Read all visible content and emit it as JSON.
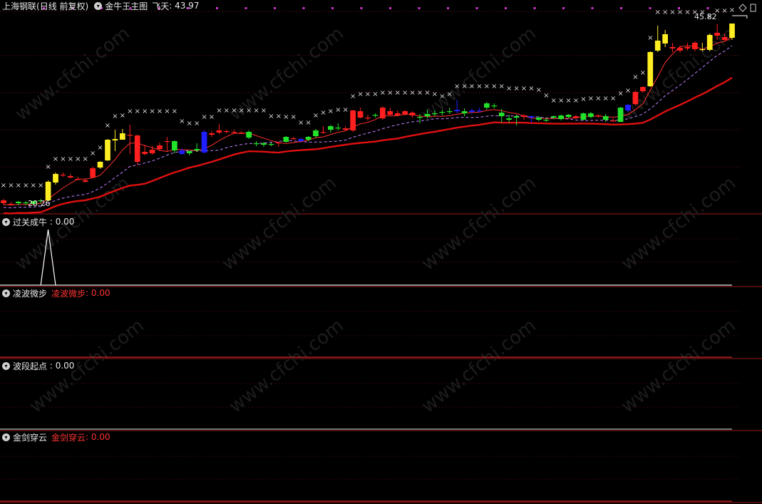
{
  "main": {
    "stock_name": "上海钢联",
    "period": "(日线 前复权)",
    "indicator": "金牛王主图",
    "line_label": "飞天",
    "line_value": "43.97",
    "high_label": "45.82",
    "low_label": "20.26"
  },
  "panels": [
    {
      "name": "过关成牛",
      "value": "0.00"
    },
    {
      "name": "凌波微步",
      "alt_name": "凌波微步",
      "value": "0.00"
    },
    {
      "name": "波段起点",
      "value": "0.00"
    },
    {
      "name": "金剑穿云",
      "alt_name": "金剑穿云",
      "value": "0.00"
    }
  ],
  "watermark": "www.cfchi.com",
  "chart_data": {
    "type": "candlestick",
    "title": "上海钢联 (日线 前复权)",
    "ylim": [
      19.5,
      47.5
    ],
    "series": [
      {
        "name": "K线",
        "note": "candles o/h/l/c/color",
        "candles": [
          [
            21.0,
            21.2,
            20.3,
            20.6,
            "r"
          ],
          [
            20.5,
            20.8,
            20.3,
            20.5,
            "r"
          ],
          [
            20.6,
            20.9,
            20.3,
            20.8,
            "g"
          ],
          [
            20.7,
            20.9,
            20.3,
            20.6,
            "g"
          ],
          [
            20.5,
            20.9,
            20.3,
            20.9,
            "g"
          ],
          [
            21.0,
            21.2,
            20.6,
            21.0,
            "g"
          ],
          [
            21.0,
            23.8,
            20.9,
            23.6,
            "y"
          ],
          [
            23.5,
            24.9,
            23.2,
            24.7,
            "y"
          ],
          [
            24.6,
            24.9,
            24.3,
            24.5,
            "r"
          ],
          [
            24.4,
            24.7,
            24.1,
            24.2,
            "r"
          ],
          [
            24.0,
            24.3,
            23.8,
            23.9,
            "r"
          ],
          [
            23.8,
            24.1,
            23.5,
            23.6,
            "r"
          ],
          [
            24.2,
            25.7,
            24.1,
            25.5,
            "r"
          ],
          [
            25.6,
            26.5,
            25.4,
            26.4,
            "y"
          ],
          [
            26.6,
            29.6,
            26.5,
            29.5,
            "y"
          ],
          [
            29.4,
            30.9,
            27.9,
            29.6,
            "y"
          ],
          [
            29.5,
            31.0,
            29.5,
            30.4,
            "y"
          ],
          [
            30.2,
            31.6,
            27.5,
            30.2,
            "r"
          ],
          [
            30.1,
            30.2,
            26.0,
            26.4,
            "r"
          ],
          [
            27.5,
            28.8,
            27.3,
            27.8,
            "r"
          ],
          [
            27.6,
            28.6,
            27.4,
            28.1,
            "r"
          ],
          [
            28.2,
            29.1,
            27.9,
            28.7,
            "r"
          ],
          [
            29.3,
            29.9,
            27.8,
            29.2,
            "r"
          ],
          [
            29.3,
            29.4,
            27.6,
            28.0,
            "g"
          ],
          [
            28.0,
            28.3,
            27.4,
            27.5,
            "b"
          ],
          [
            27.6,
            28.0,
            27.3,
            27.9,
            "g"
          ],
          [
            28.0,
            29.0,
            27.8,
            28.2,
            "g"
          ],
          [
            27.7,
            30.8,
            27.6,
            30.6,
            "b"
          ],
          [
            30.2,
            30.7,
            29.9,
            30.4,
            "r"
          ],
          [
            30.5,
            31.7,
            30.3,
            30.8,
            "r"
          ],
          [
            30.6,
            30.9,
            30.4,
            30.7,
            "r"
          ],
          [
            30.6,
            30.9,
            30.3,
            30.5,
            "r"
          ],
          [
            30.4,
            30.7,
            30.3,
            30.5,
            "r"
          ],
          [
            29.8,
            30.8,
            29.6,
            30.6,
            "g"
          ],
          [
            28.9,
            29.3,
            28.6,
            29.0,
            "g"
          ],
          [
            28.8,
            29.2,
            28.5,
            29.0,
            "g"
          ],
          [
            28.9,
            29.1,
            28.6,
            28.8,
            "g"
          ],
          [
            29.0,
            29.2,
            28.5,
            29.1,
            "r"
          ],
          [
            29.2,
            30.0,
            29.1,
            29.9,
            "g"
          ],
          [
            29.6,
            29.9,
            29.5,
            29.7,
            "r"
          ],
          [
            29.3,
            29.8,
            29.2,
            29.6,
            "b"
          ],
          [
            29.5,
            30.0,
            29.3,
            29.9,
            "g"
          ],
          [
            30.0,
            31.0,
            29.8,
            30.8,
            "g"
          ],
          [
            30.6,
            31.4,
            30.3,
            30.5,
            "r"
          ],
          [
            30.9,
            31.6,
            30.5,
            31.4,
            "g"
          ],
          [
            31.2,
            31.8,
            30.8,
            31.1,
            "g"
          ],
          [
            31.1,
            31.4,
            30.7,
            30.9,
            "r"
          ],
          [
            30.8,
            33.7,
            30.6,
            33.6,
            "r"
          ],
          [
            33.5,
            34.0,
            32.5,
            32.6,
            "r"
          ],
          [
            32.6,
            33.0,
            32.2,
            32.5,
            "r"
          ],
          [
            32.9,
            33.2,
            32.6,
            33.0,
            "g"
          ],
          [
            32.5,
            34.2,
            32.3,
            34.0,
            "r"
          ],
          [
            33.5,
            34.0,
            32.8,
            33.0,
            "r"
          ],
          [
            33.2,
            33.6,
            32.8,
            32.9,
            "r"
          ],
          [
            33.1,
            33.7,
            32.9,
            33.5,
            "r"
          ],
          [
            33.3,
            33.5,
            32.6,
            32.9,
            "r"
          ],
          [
            32.6,
            33.1,
            31.8,
            32.7,
            "g"
          ],
          [
            33.1,
            33.7,
            32.5,
            32.8,
            "g"
          ],
          [
            33.2,
            33.6,
            32.8,
            33.1,
            "g"
          ],
          [
            33.3,
            33.7,
            32.9,
            33.4,
            "g"
          ],
          [
            33.5,
            34.0,
            33.1,
            33.4,
            "g"
          ],
          [
            33.5,
            35.1,
            33.2,
            33.7,
            "b"
          ],
          [
            33.2,
            33.9,
            32.8,
            33.5,
            "g"
          ],
          [
            33.4,
            33.9,
            33.1,
            33.6,
            "b"
          ],
          [
            33.5,
            34.0,
            33.3,
            33.6,
            "b"
          ],
          [
            34.0,
            34.8,
            33.7,
            34.6,
            "g"
          ],
          [
            34.2,
            34.6,
            33.9,
            34.3,
            "g"
          ],
          [
            33.3,
            33.8,
            31.9,
            32.8,
            "g"
          ],
          [
            32.5,
            33.0,
            31.9,
            32.3,
            "g"
          ],
          [
            32.6,
            33.0,
            31.5,
            32.8,
            "g"
          ],
          [
            32.7,
            33.1,
            32.3,
            32.9,
            "r"
          ],
          [
            32.6,
            32.9,
            31.9,
            32.8,
            "b"
          ],
          [
            32.3,
            32.8,
            32.1,
            32.6,
            "g"
          ],
          [
            32.2,
            32.6,
            32.0,
            32.3,
            "g"
          ],
          [
            32.6,
            32.9,
            32.4,
            32.8,
            "g"
          ],
          [
            32.4,
            33.0,
            32.2,
            32.9,
            "g"
          ],
          [
            32.7,
            33.1,
            32.5,
            33.0,
            "g"
          ],
          [
            32.6,
            33.0,
            32.4,
            32.8,
            "r"
          ],
          [
            32.3,
            33.3,
            32.2,
            33.2,
            "g"
          ],
          [
            32.7,
            33.4,
            32.5,
            33.2,
            "g"
          ],
          [
            32.9,
            33.1,
            32.6,
            32.8,
            "r"
          ],
          [
            32.3,
            33.1,
            32.0,
            32.8,
            "g"
          ],
          [
            32.2,
            32.5,
            32.0,
            32.2,
            "r"
          ],
          [
            32.0,
            34.1,
            32.0,
            34.0,
            "g"
          ],
          [
            33.6,
            34.5,
            33.4,
            34.4,
            "b"
          ],
          [
            34.5,
            36.4,
            34.3,
            36.2,
            "r"
          ],
          [
            36.3,
            37.0,
            36.1,
            36.9,
            "r"
          ],
          [
            37.0,
            41.9,
            36.9,
            41.8,
            "y"
          ],
          [
            42.0,
            45.5,
            41.8,
            43.4,
            "y"
          ],
          [
            43.0,
            44.9,
            42.5,
            44.3,
            "y"
          ],
          [
            42.5,
            43.1,
            41.8,
            42.3,
            "r"
          ],
          [
            42.4,
            42.7,
            41.7,
            42.0,
            "r"
          ],
          [
            42.5,
            43.1,
            42.0,
            42.3,
            "r"
          ],
          [
            42.2,
            43.3,
            41.9,
            43.1,
            "r"
          ],
          [
            42.2,
            43.1,
            41.9,
            42.2,
            "y"
          ],
          [
            42.1,
            44.4,
            41.9,
            44.2,
            "y"
          ],
          [
            44.1,
            45.7,
            43.5,
            44.5,
            "r"
          ],
          [
            43.9,
            44.4,
            43.3,
            43.5,
            "r"
          ],
          [
            43.8,
            45.8,
            43.5,
            45.8,
            "y"
          ]
        ]
      }
    ]
  }
}
